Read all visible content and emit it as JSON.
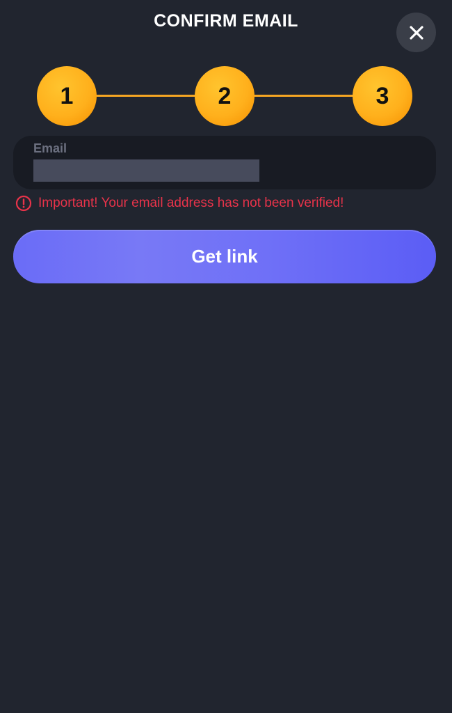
{
  "modal": {
    "title": "CONFIRM EMAIL",
    "close_icon": "close-icon"
  },
  "stepper": {
    "steps": [
      {
        "label": "1"
      },
      {
        "label": "2"
      },
      {
        "label": "3"
      }
    ],
    "accent_color": "#f5a623"
  },
  "email_field": {
    "label": "Email",
    "value": "",
    "placeholder": ""
  },
  "warning": {
    "icon": "alert-circle-icon",
    "text": "Important! Your email address has not been verified!",
    "color": "#e8334a"
  },
  "actions": {
    "get_link_label": "Get link",
    "button_color": "#6a6cf7"
  }
}
